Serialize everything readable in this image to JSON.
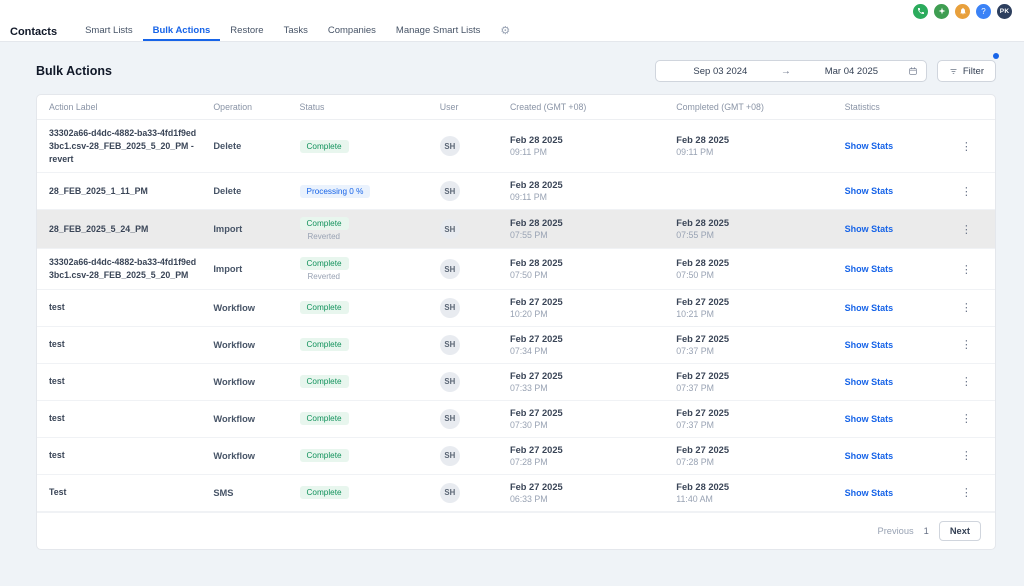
{
  "topbar": {
    "avatar_initials": "PK"
  },
  "nav": {
    "title": "Contacts",
    "tabs": [
      {
        "label": "Smart Lists",
        "active": false
      },
      {
        "label": "Bulk Actions",
        "active": true
      },
      {
        "label": "Restore",
        "active": false
      },
      {
        "label": "Tasks",
        "active": false
      },
      {
        "label": "Companies",
        "active": false
      },
      {
        "label": "Manage Smart Lists",
        "active": false
      }
    ]
  },
  "main": {
    "title": "Bulk Actions",
    "date_range": {
      "start": "Sep 03 2024",
      "arrow": "→",
      "end": "Mar 04 2025"
    },
    "filter_label": "Filter"
  },
  "table": {
    "columns": [
      "Action Label",
      "Operation",
      "Status",
      "User",
      "Created (GMT +08)",
      "Completed (GMT +08)",
      "Statistics",
      ""
    ],
    "stats_label": "Show Stats",
    "rows": [
      {
        "action_label": "33302a66-d4dc-4882-ba33-4fd1f9ed3bc1.csv-28_FEB_2025_5_20_PM - revert",
        "operation": "Delete",
        "status": "Complete",
        "status_type": "complete",
        "status_secondary": "",
        "user": "SH",
        "created_date": "Feb 28 2025",
        "created_time": "09:11 PM",
        "completed_date": "Feb 28 2025",
        "completed_time": "09:11 PM",
        "highlighted": false
      },
      {
        "action_label": "28_FEB_2025_1_11_PM",
        "operation": "Delete",
        "status": "Processing 0 %",
        "status_type": "processing",
        "status_secondary": "",
        "user": "SH",
        "created_date": "Feb 28 2025",
        "created_time": "09:11 PM",
        "completed_date": "",
        "completed_time": "",
        "highlighted": false
      },
      {
        "action_label": "28_FEB_2025_5_24_PM",
        "operation": "Import",
        "status": "Complete",
        "status_type": "complete",
        "status_secondary": "Reverted",
        "user": "SH",
        "created_date": "Feb 28 2025",
        "created_time": "07:55 PM",
        "completed_date": "Feb 28 2025",
        "completed_time": "07:55 PM",
        "highlighted": true
      },
      {
        "action_label": "33302a66-d4dc-4882-ba33-4fd1f9ed3bc1.csv-28_FEB_2025_5_20_PM",
        "operation": "Import",
        "status": "Complete",
        "status_type": "complete",
        "status_secondary": "Reverted",
        "user": "SH",
        "created_date": "Feb 28 2025",
        "created_time": "07:50 PM",
        "completed_date": "Feb 28 2025",
        "completed_time": "07:50 PM",
        "highlighted": false
      },
      {
        "action_label": "test",
        "operation": "Workflow",
        "status": "Complete",
        "status_type": "complete",
        "status_secondary": "",
        "user": "SH",
        "created_date": "Feb 27 2025",
        "created_time": "10:20 PM",
        "completed_date": "Feb 27 2025",
        "completed_time": "10:21 PM",
        "highlighted": false
      },
      {
        "action_label": "test",
        "operation": "Workflow",
        "status": "Complete",
        "status_type": "complete",
        "status_secondary": "",
        "user": "SH",
        "created_date": "Feb 27 2025",
        "created_time": "07:34 PM",
        "completed_date": "Feb 27 2025",
        "completed_time": "07:37 PM",
        "highlighted": false
      },
      {
        "action_label": "test",
        "operation": "Workflow",
        "status": "Complete",
        "status_type": "complete",
        "status_secondary": "",
        "user": "SH",
        "created_date": "Feb 27 2025",
        "created_time": "07:33 PM",
        "completed_date": "Feb 27 2025",
        "completed_time": "07:37 PM",
        "highlighted": false
      },
      {
        "action_label": "test",
        "operation": "Workflow",
        "status": "Complete",
        "status_type": "complete",
        "status_secondary": "",
        "user": "SH",
        "created_date": "Feb 27 2025",
        "created_time": "07:30 PM",
        "completed_date": "Feb 27 2025",
        "completed_time": "07:37 PM",
        "highlighted": false
      },
      {
        "action_label": "test",
        "operation": "Workflow",
        "status": "Complete",
        "status_type": "complete",
        "status_secondary": "",
        "user": "SH",
        "created_date": "Feb 27 2025",
        "created_time": "07:28 PM",
        "completed_date": "Feb 27 2025",
        "completed_time": "07:28 PM",
        "highlighted": false
      },
      {
        "action_label": "Test",
        "operation": "SMS",
        "status": "Complete",
        "status_type": "complete",
        "status_secondary": "",
        "user": "SH",
        "created_date": "Feb 27 2025",
        "created_time": "06:33 PM",
        "completed_date": "Feb 28 2025",
        "completed_time": "11:40 AM",
        "highlighted": false
      }
    ]
  },
  "pagination": {
    "previous": "Previous",
    "page": "1",
    "next": "Next"
  },
  "colors": {
    "accent_blue": "#1764e8",
    "success_green": "#12925c",
    "badge_green_bg": "#e8f6ee",
    "badge_blue_bg": "#eaf2fd"
  }
}
